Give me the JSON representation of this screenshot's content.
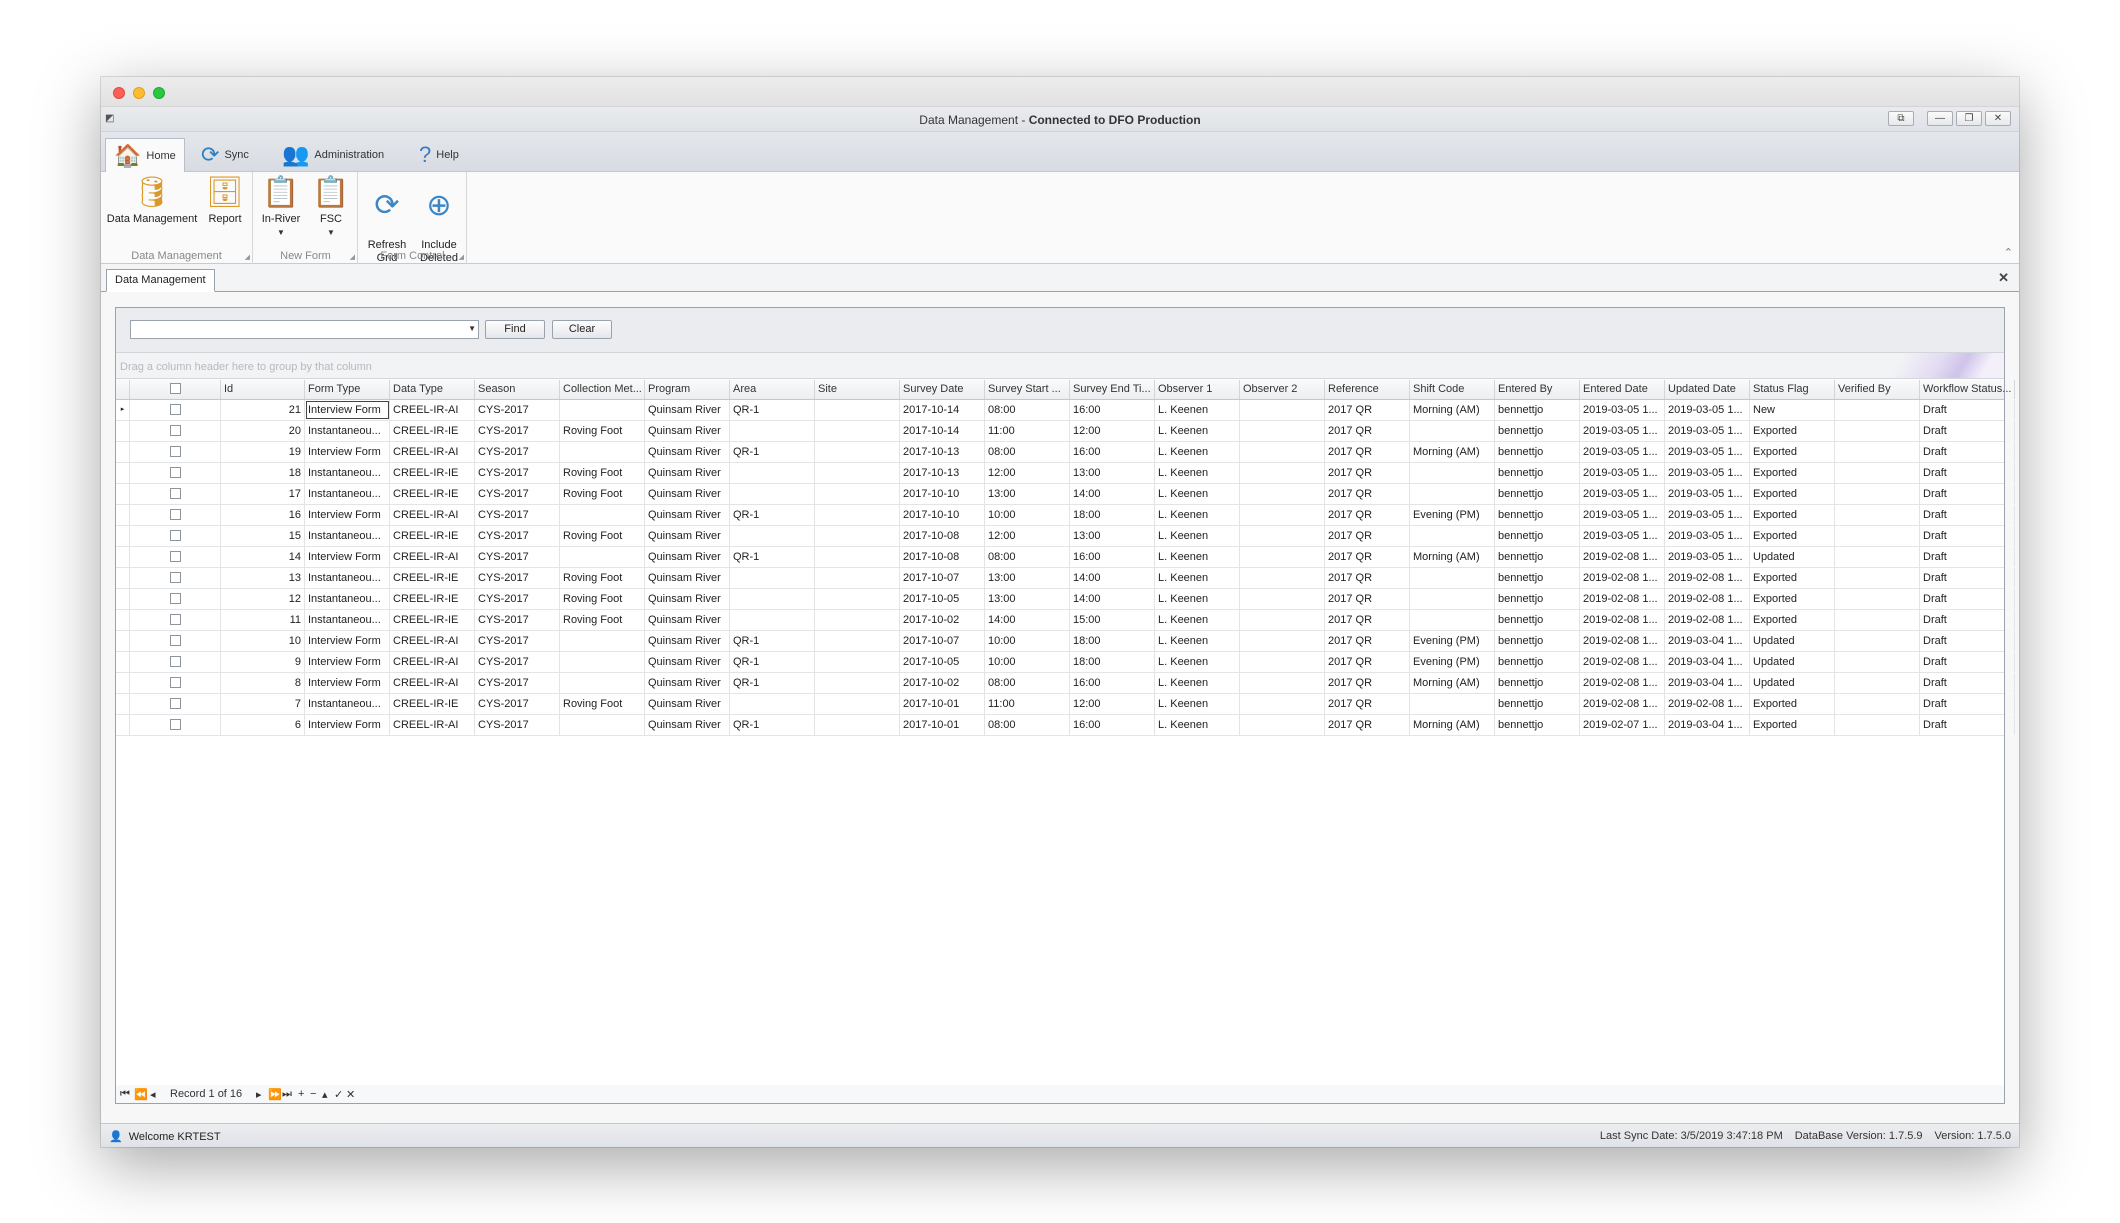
{
  "window": {
    "title_prefix": "Data Management - ",
    "title_connection": "Connected to DFO Production",
    "buttons": [
      "⧉",
      "—",
      "❐",
      "✕"
    ]
  },
  "ribbon": {
    "tabs": [
      {
        "label": "Home",
        "icon": "home-icon"
      },
      {
        "label": "Sync",
        "icon": "sync-icon"
      },
      {
        "label": "Administration",
        "icon": "administration-icon"
      },
      {
        "label": "Help",
        "icon": "help-icon"
      }
    ],
    "groups": {
      "data_management": {
        "label": "Data Management",
        "buttons": [
          "Data Management",
          "Report"
        ]
      },
      "new_form": {
        "label": "New Form",
        "buttons": [
          "In-River",
          "FSC"
        ]
      },
      "form_control": {
        "label": "Form Control",
        "buttons": [
          "Refresh\nGrid",
          "Include\nDeleted"
        ]
      }
    }
  },
  "doc_tab": {
    "label": "Data Management"
  },
  "search": {
    "value": "",
    "find_label": "Find",
    "clear_label": "Clear"
  },
  "group_hint": "Drag a column header here to group by that column",
  "grid": {
    "columns": [
      "Id",
      "Form Type",
      "Data Type",
      "Season",
      "Collection Met...",
      "Program",
      "Area",
      "Site",
      "Survey Date",
      "Survey Start ...",
      "Survey End Ti...",
      "Observer 1",
      "Observer 2",
      "Reference",
      "Shift Code",
      "Entered By",
      "Entered Date",
      "Updated Date",
      "Status Flag",
      "Verified By",
      "Workflow Status..."
    ],
    "rows": [
      [
        "21",
        "Interview Form",
        "CREEL-IR-AI",
        "CYS-2017",
        "",
        "Quinsam River",
        "QR-1",
        "",
        "2017-10-14",
        "08:00",
        "16:00",
        "L. Keenen",
        "",
        "2017 QR",
        "Morning (AM)",
        "bennettjo",
        "2019-03-05 1...",
        "2019-03-05 1...",
        "New",
        "",
        "Draft"
      ],
      [
        "20",
        "Instantaneou...",
        "CREEL-IR-IE",
        "CYS-2017",
        "Roving Foot",
        "Quinsam River",
        "",
        "",
        "2017-10-14",
        "11:00",
        "12:00",
        "L. Keenen",
        "",
        "2017 QR",
        "",
        "bennettjo",
        "2019-03-05 1...",
        "2019-03-05 1...",
        "Exported",
        "",
        "Draft"
      ],
      [
        "19",
        "Interview Form",
        "CREEL-IR-AI",
        "CYS-2017",
        "",
        "Quinsam River",
        "QR-1",
        "",
        "2017-10-13",
        "08:00",
        "16:00",
        "L. Keenen",
        "",
        "2017 QR",
        "Morning (AM)",
        "bennettjo",
        "2019-03-05 1...",
        "2019-03-05 1...",
        "Exported",
        "",
        "Draft"
      ],
      [
        "18",
        "Instantaneou...",
        "CREEL-IR-IE",
        "CYS-2017",
        "Roving Foot",
        "Quinsam River",
        "",
        "",
        "2017-10-13",
        "12:00",
        "13:00",
        "L. Keenen",
        "",
        "2017 QR",
        "",
        "bennettjo",
        "2019-03-05 1...",
        "2019-03-05 1...",
        "Exported",
        "",
        "Draft"
      ],
      [
        "17",
        "Instantaneou...",
        "CREEL-IR-IE",
        "CYS-2017",
        "Roving Foot",
        "Quinsam River",
        "",
        "",
        "2017-10-10",
        "13:00",
        "14:00",
        "L. Keenen",
        "",
        "2017 QR",
        "",
        "bennettjo",
        "2019-03-05 1...",
        "2019-03-05 1...",
        "Exported",
        "",
        "Draft"
      ],
      [
        "16",
        "Interview Form",
        "CREEL-IR-AI",
        "CYS-2017",
        "",
        "Quinsam River",
        "QR-1",
        "",
        "2017-10-10",
        "10:00",
        "18:00",
        "L. Keenen",
        "",
        "2017 QR",
        "Evening (PM)",
        "bennettjo",
        "2019-03-05 1...",
        "2019-03-05 1...",
        "Exported",
        "",
        "Draft"
      ],
      [
        "15",
        "Instantaneou...",
        "CREEL-IR-IE",
        "CYS-2017",
        "Roving Foot",
        "Quinsam River",
        "",
        "",
        "2017-10-08",
        "12:00",
        "13:00",
        "L. Keenen",
        "",
        "2017 QR",
        "",
        "bennettjo",
        "2019-03-05 1...",
        "2019-03-05 1...",
        "Exported",
        "",
        "Draft"
      ],
      [
        "14",
        "Interview Form",
        "CREEL-IR-AI",
        "CYS-2017",
        "",
        "Quinsam River",
        "QR-1",
        "",
        "2017-10-08",
        "08:00",
        "16:00",
        "L. Keenen",
        "",
        "2017 QR",
        "Morning (AM)",
        "bennettjo",
        "2019-02-08 1...",
        "2019-03-05 1...",
        "Updated",
        "",
        "Draft"
      ],
      [
        "13",
        "Instantaneou...",
        "CREEL-IR-IE",
        "CYS-2017",
        "Roving Foot",
        "Quinsam River",
        "",
        "",
        "2017-10-07",
        "13:00",
        "14:00",
        "L. Keenen",
        "",
        "2017 QR",
        "",
        "bennettjo",
        "2019-02-08 1...",
        "2019-02-08 1...",
        "Exported",
        "",
        "Draft"
      ],
      [
        "12",
        "Instantaneou...",
        "CREEL-IR-IE",
        "CYS-2017",
        "Roving Foot",
        "Quinsam River",
        "",
        "",
        "2017-10-05",
        "13:00",
        "14:00",
        "L. Keenen",
        "",
        "2017 QR",
        "",
        "bennettjo",
        "2019-02-08 1...",
        "2019-02-08 1...",
        "Exported",
        "",
        "Draft"
      ],
      [
        "11",
        "Instantaneou...",
        "CREEL-IR-IE",
        "CYS-2017",
        "Roving Foot",
        "Quinsam River",
        "",
        "",
        "2017-10-02",
        "14:00",
        "15:00",
        "L. Keenen",
        "",
        "2017 QR",
        "",
        "bennettjo",
        "2019-02-08 1...",
        "2019-02-08 1...",
        "Exported",
        "",
        "Draft"
      ],
      [
        "10",
        "Interview Form",
        "CREEL-IR-AI",
        "CYS-2017",
        "",
        "Quinsam River",
        "QR-1",
        "",
        "2017-10-07",
        "10:00",
        "18:00",
        "L. Keenen",
        "",
        "2017 QR",
        "Evening (PM)",
        "bennettjo",
        "2019-02-08 1...",
        "2019-03-04 1...",
        "Updated",
        "",
        "Draft"
      ],
      [
        "9",
        "Interview Form",
        "CREEL-IR-AI",
        "CYS-2017",
        "",
        "Quinsam River",
        "QR-1",
        "",
        "2017-10-05",
        "10:00",
        "18:00",
        "L. Keenen",
        "",
        "2017 QR",
        "Evening (PM)",
        "bennettjo",
        "2019-02-08 1...",
        "2019-03-04 1...",
        "Updated",
        "",
        "Draft"
      ],
      [
        "8",
        "Interview Form",
        "CREEL-IR-AI",
        "CYS-2017",
        "",
        "Quinsam River",
        "QR-1",
        "",
        "2017-10-02",
        "08:00",
        "16:00",
        "L. Keenen",
        "",
        "2017 QR",
        "Morning (AM)",
        "bennettjo",
        "2019-02-08 1...",
        "2019-03-04 1...",
        "Updated",
        "",
        "Draft"
      ],
      [
        "7",
        "Instantaneou...",
        "CREEL-IR-IE",
        "CYS-2017",
        "Roving Foot",
        "Quinsam River",
        "",
        "",
        "2017-10-01",
        "11:00",
        "12:00",
        "L. Keenen",
        "",
        "2017 QR",
        "",
        "bennettjo",
        "2019-02-08 1...",
        "2019-02-08 1...",
        "Exported",
        "",
        "Draft"
      ],
      [
        "6",
        "Interview Form",
        "CREEL-IR-AI",
        "CYS-2017",
        "",
        "Quinsam River",
        "QR-1",
        "",
        "2017-10-01",
        "08:00",
        "16:00",
        "L. Keenen",
        "",
        "2017 QR",
        "Morning (AM)",
        "bennettjo",
        "2019-02-07 1...",
        "2019-03-04 1...",
        "Exported",
        "",
        "Draft"
      ]
    ]
  },
  "navigator": {
    "record_text": "Record 1 of 16"
  },
  "status": {
    "welcome": "Welcome KRTEST",
    "last_sync": "Last Sync Date: 3/5/2019 3:47:18 PM",
    "db_version": "DataBase Version: 1.7.5.9",
    "version": "Version: 1.7.5.0"
  }
}
